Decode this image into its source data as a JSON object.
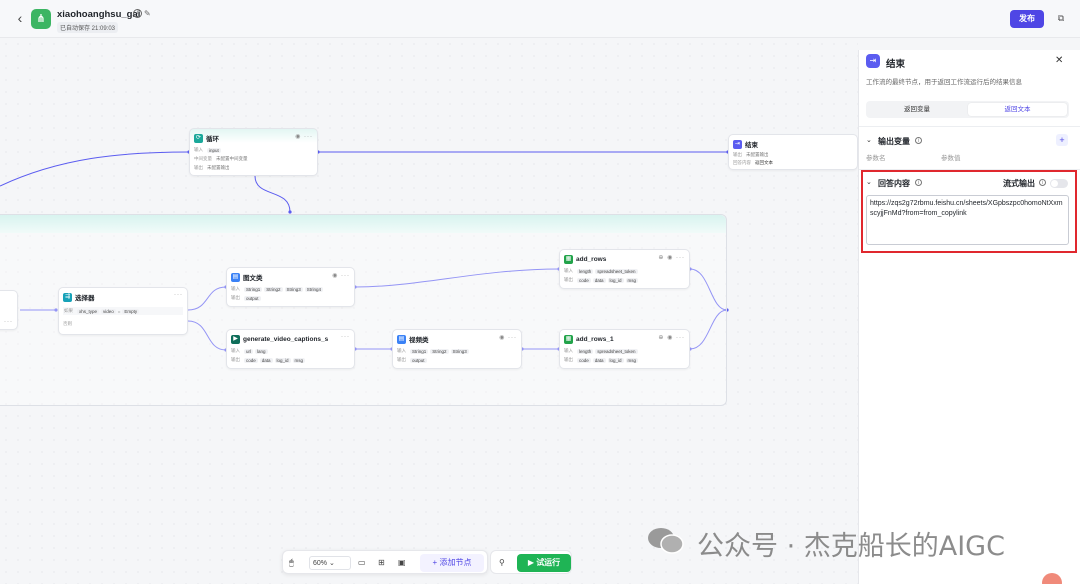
{
  "header": {
    "app_name": "xiaohoanghsu_gai",
    "autosave": "已自动保存 21:09:03",
    "publish_label": "发布"
  },
  "colors": {
    "accent": "#4f46e5",
    "run": "#1fb455",
    "highlight": "#e0282e",
    "edge": "#5b5cf0"
  },
  "canvas": {
    "loop_node": {
      "title": "循环",
      "rows": [
        {
          "label": "输入",
          "chips": [
            "input"
          ]
        },
        {
          "label": "中间变量",
          "chips": [
            "未配置中间变量"
          ]
        },
        {
          "label": "输出",
          "chips": [
            "未配置输出"
          ]
        }
      ]
    },
    "end_node": {
      "title": "结束",
      "rows": [
        {
          "label": "输出",
          "chips": [
            "未配置输出"
          ]
        },
        {
          "label": "回答内容",
          "chips": [
            "返回文本"
          ]
        }
      ]
    },
    "selector_node": {
      "title": "选择器",
      "row1": {
        "label": "如果",
        "chips": [
          "xhs_type",
          "video",
          "=",
          "Empty"
        ]
      },
      "row2": {
        "label": "否则"
      }
    },
    "image_node": {
      "title": "图文类",
      "rows": [
        {
          "label": "输入",
          "chips": [
            "String1",
            "String2",
            "String3",
            "String4"
          ]
        },
        {
          "label": "输出",
          "chips": [
            "output"
          ]
        }
      ]
    },
    "caption_node": {
      "title": "generate_video_captions_s",
      "rows": [
        {
          "label": "输入",
          "chips": [
            "url",
            "lang"
          ]
        },
        {
          "label": "输出",
          "chips": [
            "code",
            "data",
            "log_id",
            "msg"
          ]
        }
      ]
    },
    "video_node": {
      "title": "视频类",
      "rows": [
        {
          "label": "输入",
          "chips": [
            "String1",
            "String2",
            "String3"
          ]
        },
        {
          "label": "输出",
          "chips": [
            "output"
          ]
        }
      ]
    },
    "add_rows_node": {
      "title": "add_rows",
      "rows": [
        {
          "label": "输入",
          "chips": [
            "length",
            "spreadsheet_token"
          ]
        },
        {
          "label": "输出",
          "chips": [
            "code",
            "data",
            "log_id",
            "msg"
          ]
        }
      ]
    },
    "add_rows_1_node": {
      "title": "add_rows_1",
      "rows": [
        {
          "label": "输入",
          "chips": [
            "length",
            "spreadsheet_token"
          ]
        },
        {
          "label": "输出",
          "chips": [
            "code",
            "data",
            "log_id",
            "msg"
          ]
        }
      ]
    }
  },
  "panel": {
    "title": "结束",
    "description": "工作流的最终节点，用于返回工作流运行后的结果信息",
    "tabs": [
      "返回变量",
      "返回文本"
    ],
    "active_tab": "返回文本",
    "output_vars": {
      "title": "输出变量",
      "col_name": "参数名",
      "col_value": "参数值"
    },
    "answer": {
      "title": "回答内容",
      "stream_label": "流式输出",
      "stream_enabled": false,
      "text": "https://zqs2g72rbmu.feishu.cn/sheets/XGpbszpc0homoNtXxmscyjjFnMd?from=from_copylink"
    }
  },
  "toolbar": {
    "zoom": "60%",
    "add_node": "添加节点",
    "run": "试运行"
  },
  "watermark": "公众号 · 杰克船长的AIGC"
}
